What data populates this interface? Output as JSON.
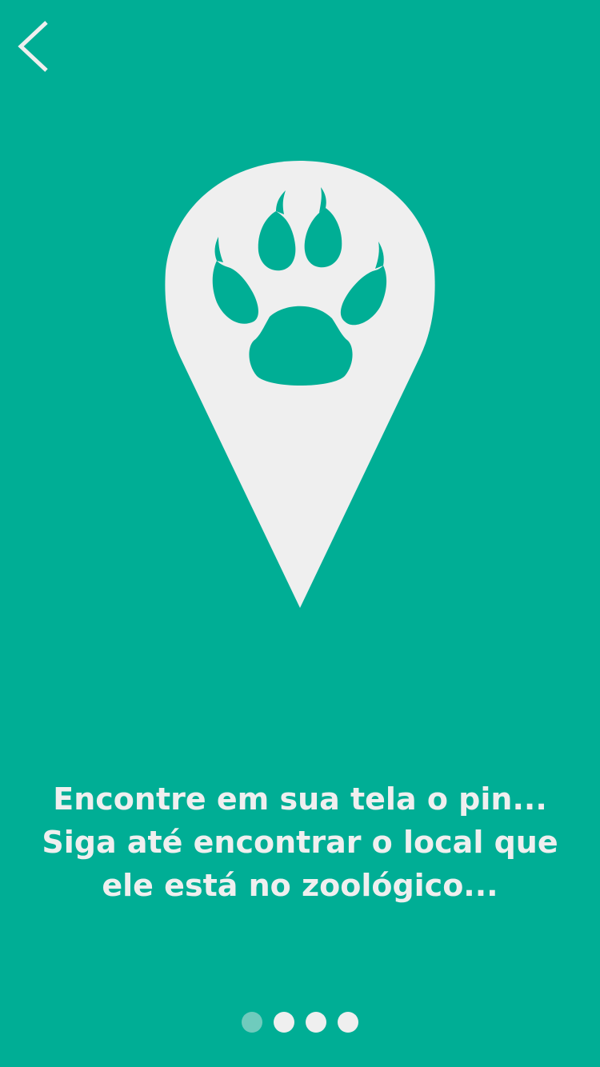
{
  "header": {
    "back_icon": "chevron-left-icon"
  },
  "hero": {
    "icon": "map-pin-paw-icon"
  },
  "message": {
    "lines": [
      "Encontre em sua tela o pin...",
      "Siga até encontrar o local que",
      "ele está no zoológico..."
    ]
  },
  "pagination": {
    "total": 4,
    "current": 1
  },
  "colors": {
    "background": "#00ae95",
    "foreground": "#efefef",
    "active_dot": "#6fcbbd"
  }
}
